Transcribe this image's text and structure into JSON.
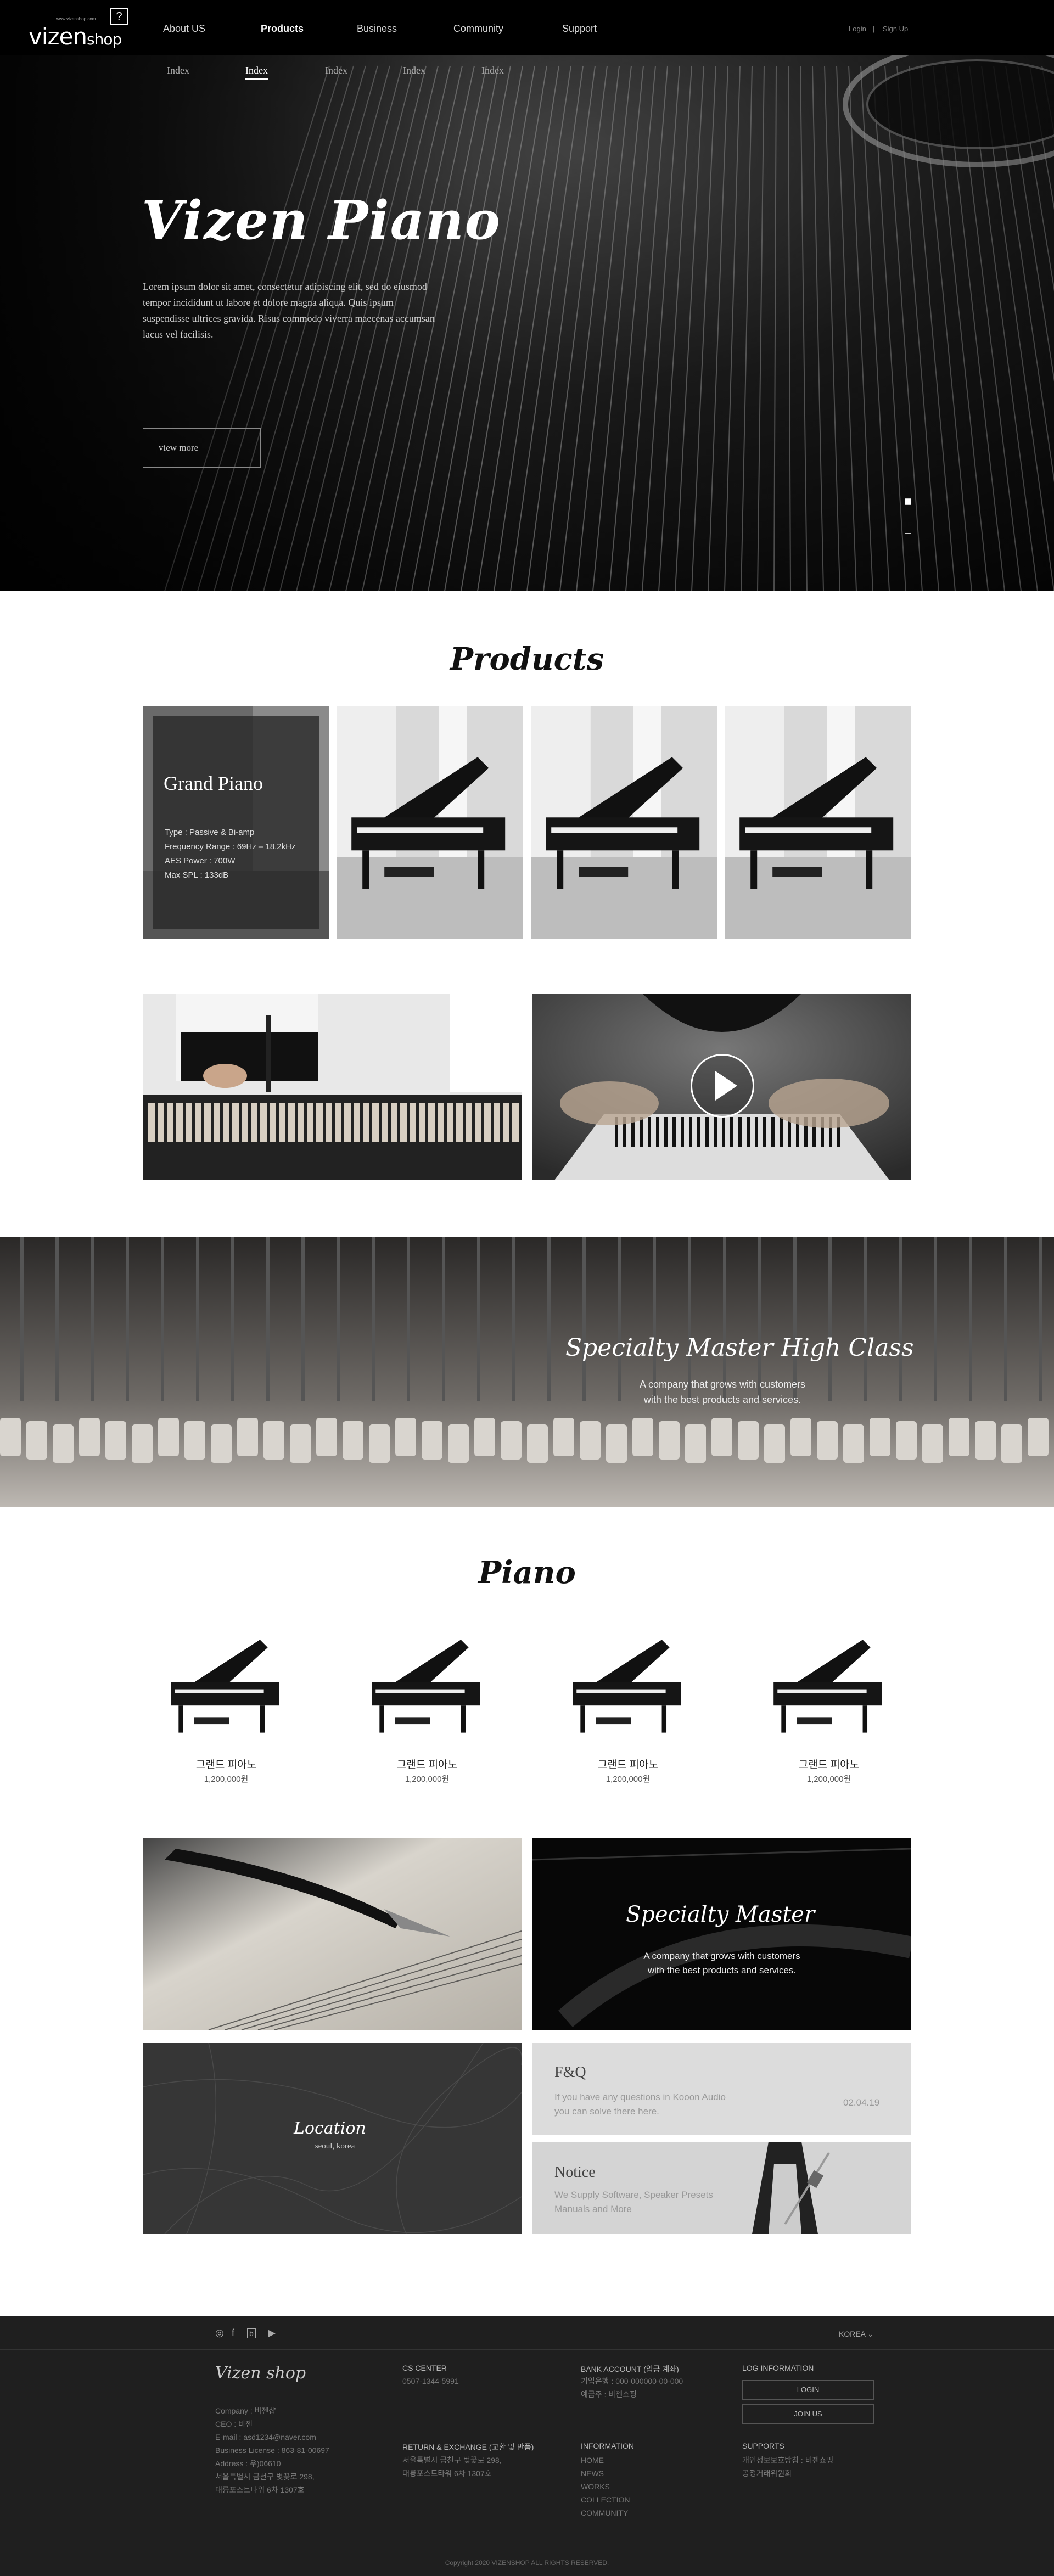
{
  "header": {
    "logo_main": "vizen",
    "logo_sub": "shop",
    "logo_tagline": "www.vizenshop.com",
    "logo_badge": "?",
    "nav": [
      "About US",
      "Products",
      "Business",
      "Community",
      "Support"
    ],
    "active_nav": "Products",
    "login": "Login",
    "separator": "|",
    "signup": "Sign Up",
    "subnav": [
      "Index",
      "Index",
      "Index",
      "Index",
      "Index"
    ]
  },
  "hero": {
    "title": "Vizen Piano",
    "text": "Lorem ipsum dolor sit amet, consectetur adipiscing elit, sed do eiusmod tempor incididunt ut labore et dolore magna aliqua. Quis ipsum suspendisse ultrices gravida. Risus commodo viverra maecenas accumsan lacus vel facilisis.",
    "button": "view more",
    "slides": 3,
    "active_slide": 1
  },
  "products": {
    "title": "Products",
    "featured": {
      "name": "Grand Piano",
      "specs": [
        "Type : Passive & Bi-amp",
        "Frequency Range : 69Hz – 18.2kHz",
        "AES Power : 700W",
        "Max SPL : 133dB"
      ]
    }
  },
  "specialty_banner": {
    "title": "Specialty Master High Class",
    "line1": "A company that grows with customers",
    "line2": "with the best products and services."
  },
  "piano": {
    "title": "Piano",
    "items": [
      {
        "name": "그랜드 피아노",
        "price": "1,200,000원"
      },
      {
        "name": "그랜드 피아노",
        "price": "1,200,000원"
      },
      {
        "name": "그랜드 피아노",
        "price": "1,200,000원"
      },
      {
        "name": "그랜드 피아노",
        "price": "1,200,000원"
      }
    ]
  },
  "tiles": {
    "specialty_title": "Specialty Master",
    "specialty_line1": "A company that grows with customers",
    "specialty_line2": "with the best products and services.",
    "location_title": "Location",
    "location_sub": "seoul, korea",
    "faq_title": "F&Q",
    "faq_line1": "If you have any questions in Kooon Audio",
    "faq_line2": "you can solve there here.",
    "faq_date": "02.04.19",
    "notice_title": "Notice",
    "notice_line1": "We Supply Software, Speaker Presets",
    "notice_line2": "Manuals and More"
  },
  "footer": {
    "language": "KOREA",
    "logo": "Vizen shop",
    "company": [
      "Company : 비젠샵",
      "CEO : 비젠",
      "E-mail : asd1234@naver.com",
      "Business License : 863-81-00697",
      "Address : 우)06610",
      "서울특별시 금천구 벚꽃로 298,",
      "대륭포스트타워 6차 1307호"
    ],
    "cs_head": "CS CENTER",
    "cs_phone": "0507-1344-5991",
    "return_head": "RETURN & EXCHANGE (교환 및 반품)",
    "return_lines": [
      "서울특별시 금천구 벚꽃로 298,",
      "대륭포스트타워 6차 1307호"
    ],
    "bank_head": "BANK ACCOUNT (입금 계좌)",
    "bank_lines": [
      "기업은행 : 000-000000-00-000",
      "예금주 : 비젠쇼핑"
    ],
    "info_head": "INFORMATION",
    "info_links": [
      "HOME",
      "NEWS",
      "WORKS",
      "COLLECTION",
      "COMMUNITY"
    ],
    "login_head": "LOG INFORMATION",
    "login_btn": "LOGIN",
    "join_btn": "JOIN US",
    "support_head": "SUPPORTS",
    "support_lines": [
      "개인정보보호방침 : 비젠쇼핑",
      "공정거래위원회"
    ],
    "copyright": "Copyright 2020 VIZENSHOP ALL RIGHTS RESERVED."
  }
}
